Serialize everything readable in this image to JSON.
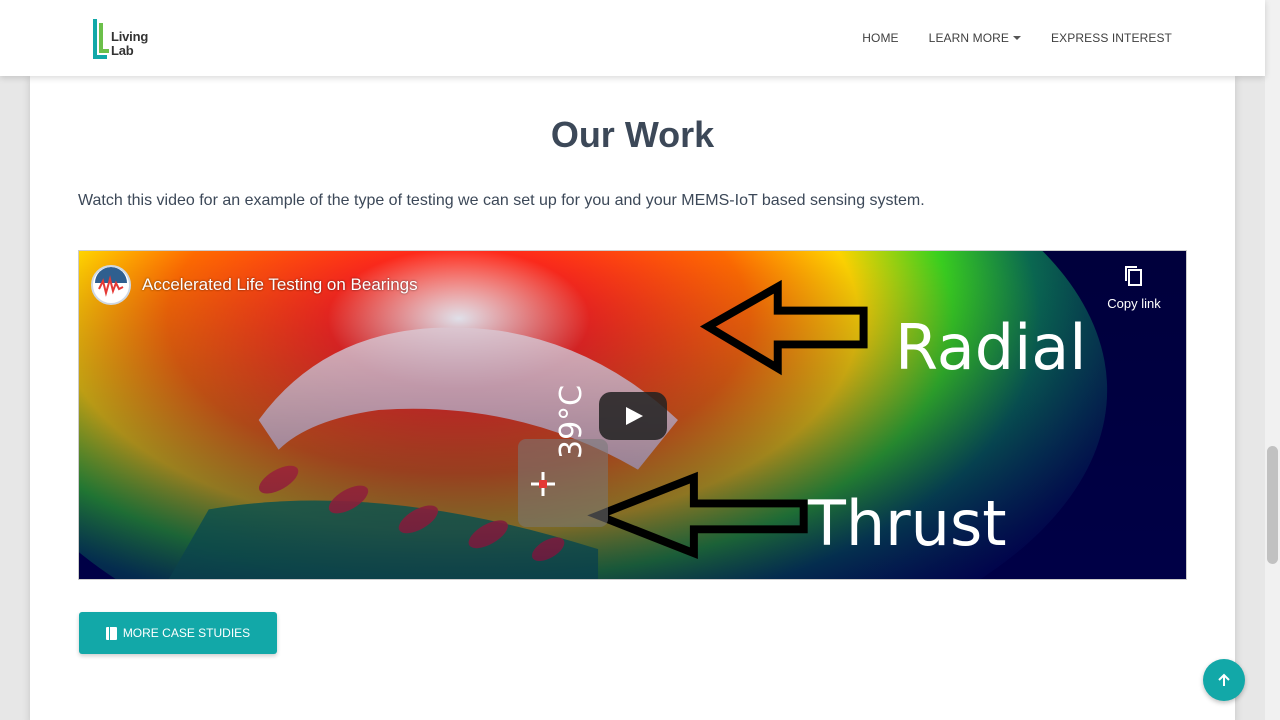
{
  "brand": {
    "logo_text_line1": "Living",
    "logo_text_line2": "Lab",
    "color": "#12a8a8"
  },
  "nav": {
    "items": [
      {
        "label": "HOME"
      },
      {
        "label": "LEARN MORE",
        "has_dropdown": true
      },
      {
        "label": "EXPRESS INTEREST"
      }
    ]
  },
  "main": {
    "title": "Our Work",
    "intro": "Watch this video for an example of the type of testing we can set up for you and your MEMS-IoT based sensing system.",
    "video": {
      "title": "Accelerated Life Testing on Bearings",
      "copy_link_label": "Copy link",
      "overlay_radial": "Radial",
      "overlay_thrust": "Thrust",
      "temperature": "39°C"
    },
    "cta_label": "MORE CASE STUDIES"
  },
  "icons": {
    "copy": "copy-icon",
    "play": "play-icon",
    "book": "book-icon",
    "back_to_top": "arrow-up-icon"
  },
  "colors": {
    "accent": "#12a8a8",
    "heading": "#3c4858"
  }
}
